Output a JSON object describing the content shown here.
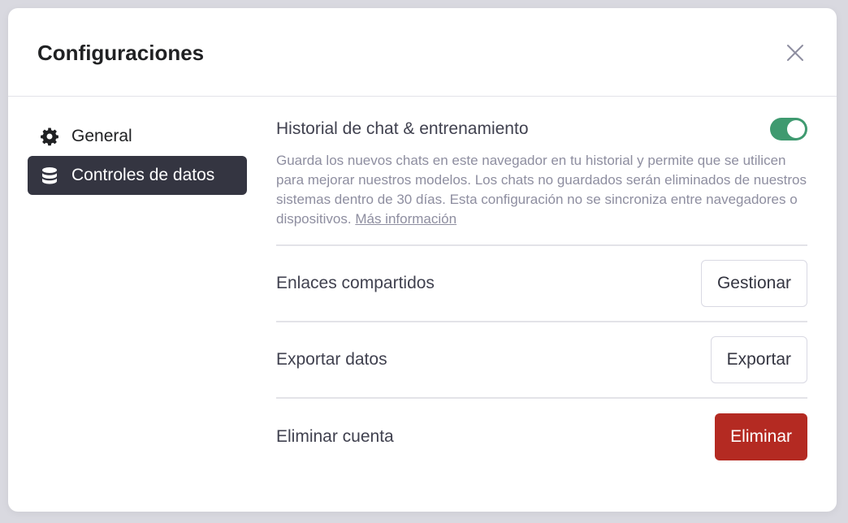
{
  "modal": {
    "title": "Configuraciones"
  },
  "sidebar": {
    "items": [
      {
        "label": "General",
        "icon": "gear-icon",
        "active": false
      },
      {
        "label": "Controles de datos",
        "icon": "database-icon",
        "active": true
      }
    ]
  },
  "history": {
    "title": "Historial de chat & entrenamiento",
    "enabled": true,
    "description": "Guarda los nuevos chats en este navegador en tu historial y permite que se utilicen para mejorar nuestros modelos. Los chats no guardados serán eliminados de nuestros sistemas dentro de 30 días. Esta configuración no se sincroniza entre navegadores o dispositivos.",
    "link_label": "Más información"
  },
  "rows": {
    "shared_links": {
      "label": "Enlaces compartidos",
      "button": "Gestionar"
    },
    "export": {
      "label": "Exportar datos",
      "button": "Exportar"
    },
    "delete": {
      "label": "Eliminar cuenta",
      "button": "Eliminar"
    }
  },
  "colors": {
    "toggle_on": "#3f9a70",
    "danger": "#b42a22",
    "active_bg": "#343541"
  }
}
